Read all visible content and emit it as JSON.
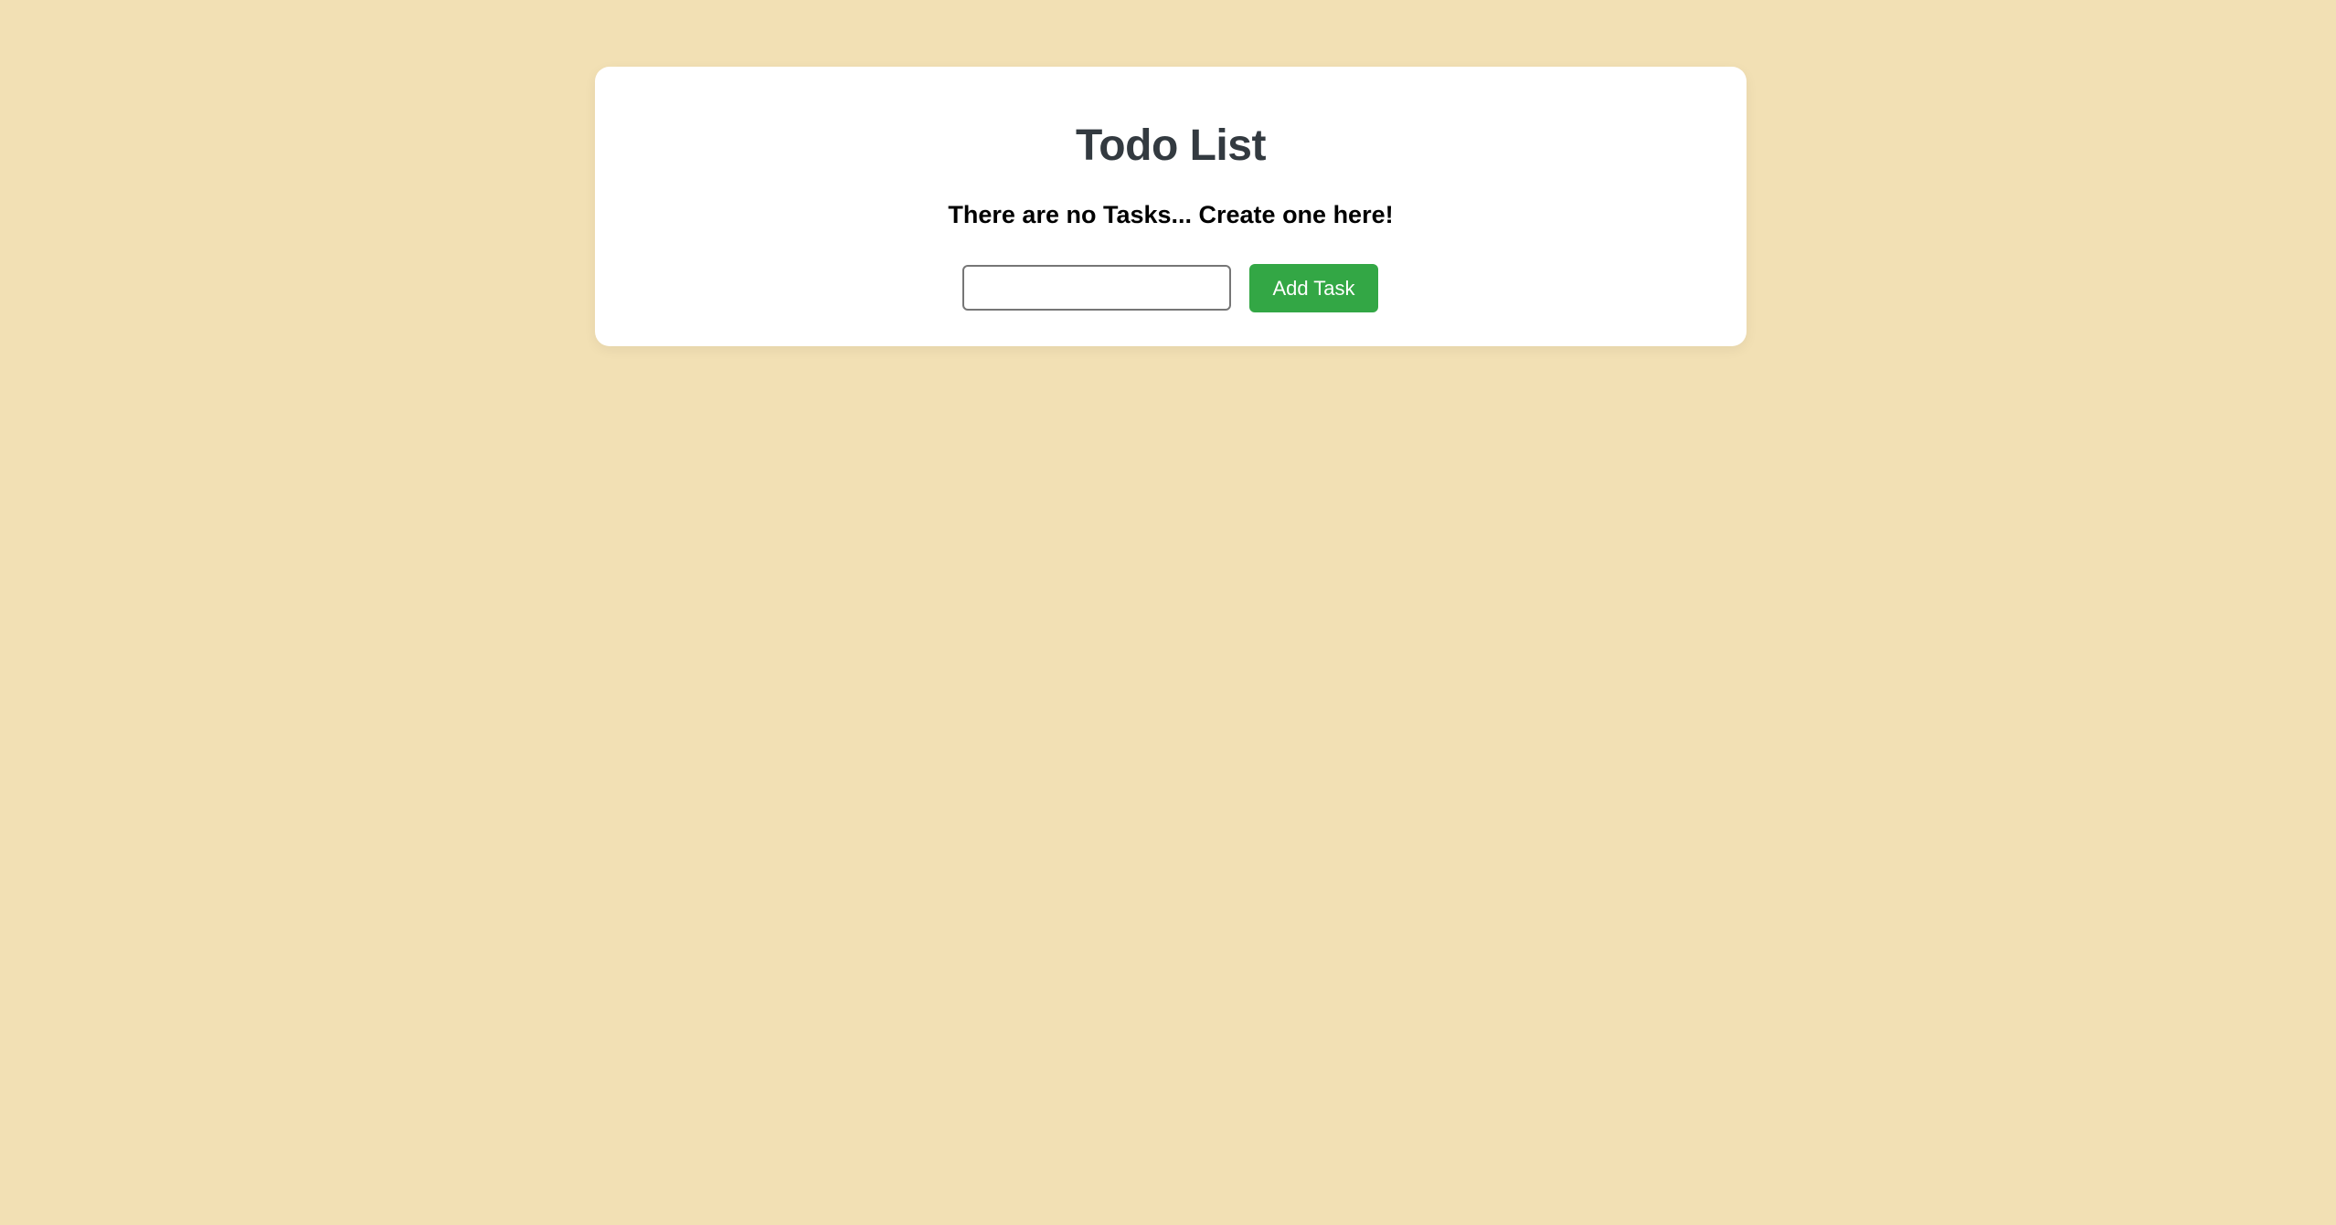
{
  "page": {
    "background_color": "#f2e0b4"
  },
  "card": {
    "title": "Todo List",
    "empty_message": "There are no Tasks... Create one here!"
  },
  "form": {
    "input_value": "",
    "input_placeholder": "",
    "add_button_label": "Add Task",
    "add_button_color": "#33a745"
  }
}
